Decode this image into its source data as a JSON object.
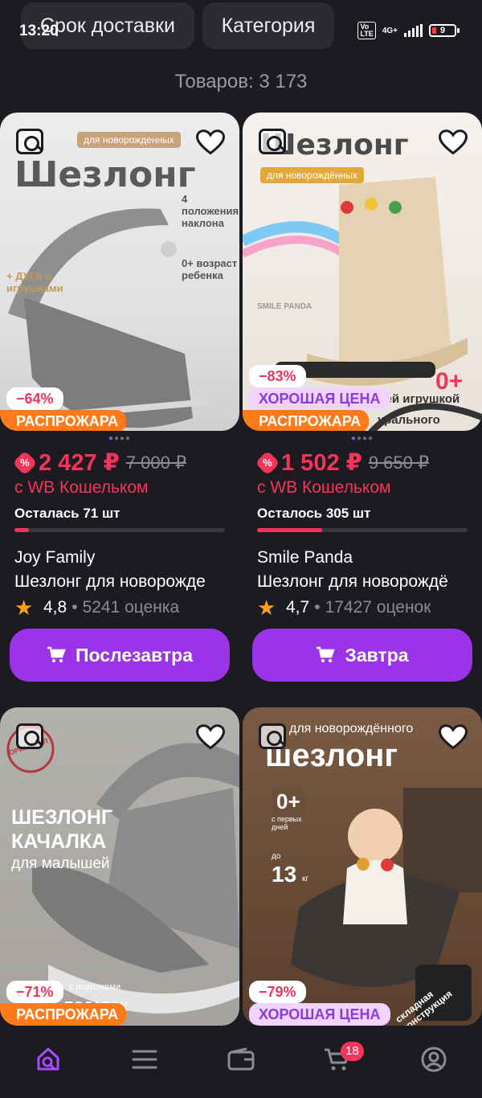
{
  "status_bar": {
    "time": "13:20",
    "network": "4G+",
    "battery": "9"
  },
  "filters": {
    "delivery_label": "Срок доставки",
    "category_label": "Категория"
  },
  "results": {
    "count_label": "Товаров: 3 173"
  },
  "products": [
    {
      "image_title": "Шезлонг",
      "image_subtitle": "для новорожденных",
      "image_fact1": "4 положения наклона",
      "image_fact2": "0+ возраст ребенка",
      "image_fact3": "+ ДУГА с игрушками",
      "discount": "−64%",
      "tag": "РАСПРОЖАРА",
      "price": "2 427 ₽",
      "old_price": "7 000 ₽",
      "wallet_text": "с WB Кошельком",
      "stock": "Осталась 71 шт",
      "stock_level": 0.07,
      "brand": "Joy Family",
      "name": "Шезлонг для новорожде",
      "rating": "4,8",
      "reviews": "5241 оценка",
      "delivery_button": "Послезавтра"
    },
    {
      "image_title": "Шезлонг",
      "image_subtitle": "для новорождённых",
      "image_fact1": "0+",
      "image_fact2": "дей игрушкой",
      "image_fact3": "урального дерева",
      "image_logo": "SMILE PANDA",
      "discount": "−83%",
      "tag2": "ХОРОШАЯ ЦЕНА",
      "tag": "РАСПРОЖАРА",
      "price": "1 502 ₽",
      "old_price": "9 650 ₽",
      "wallet_text": "с WB Кошельком",
      "stock": "Осталось 305 шт",
      "stock_level": 0.31,
      "brand": "Smile Panda",
      "name": "Шезлонг для новорождё",
      "rating": "4,7",
      "reviews": "17427 оценок",
      "delivery_button": "Завтра"
    },
    {
      "image_title": "ШЕЗЛОНГ КАЧАЛКА",
      "image_subtitle": "для малышей",
      "image_stamp": "ОРИГИНАЛ",
      "image_fact1": "с игрушками",
      "image_fact2": "ПОДАРОК",
      "discount": "−71%",
      "tag": "РАСПРОЖАРА"
    },
    {
      "image_title": "шезлонг",
      "image_subtitle": "для новорождённого",
      "image_fact1": "0+",
      "image_fact1_sub": "с первых дней",
      "image_fact2": "13",
      "image_fact2_pre": "до",
      "image_fact2_unit": "кг",
      "image_fact3": "складная конструкция",
      "discount": "−79%",
      "tag2": "ХОРОШАЯ ЦЕНА"
    }
  ],
  "bottom_nav": {
    "items": [
      "home-icon",
      "catalog-icon",
      "wallet-icon",
      "cart-icon",
      "profile-icon"
    ],
    "cart_count": "18",
    "accent_color": "#9b33e9"
  },
  "colors": {
    "price": "#f5345a",
    "button": "#9b33e9",
    "sale_tag": "#ff7a1a"
  }
}
